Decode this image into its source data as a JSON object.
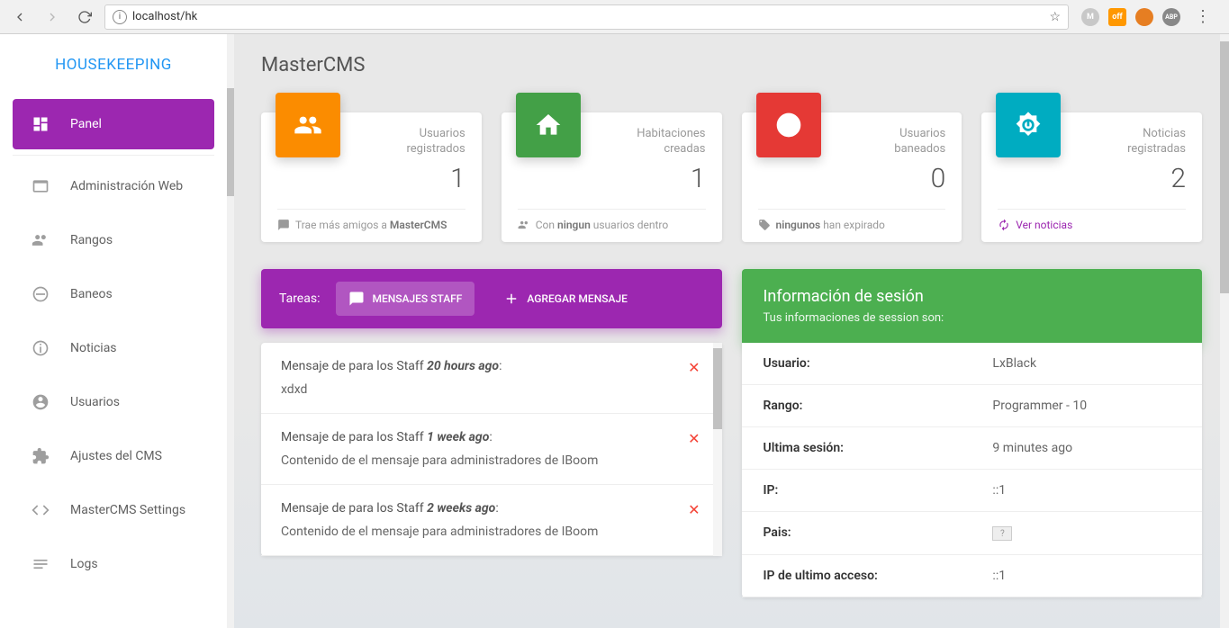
{
  "browser": {
    "url": "localhost/hk"
  },
  "sidebar": {
    "title": "HOUSEKEEPING",
    "items": [
      {
        "label": "Panel"
      },
      {
        "label": "Administración Web"
      },
      {
        "label": "Rangos"
      },
      {
        "label": "Baneos"
      },
      {
        "label": "Noticias"
      },
      {
        "label": "Usuarios"
      },
      {
        "label": "Ajustes del CMS"
      },
      {
        "label": "MasterCMS Settings"
      },
      {
        "label": "Logs"
      }
    ]
  },
  "page": {
    "title": "MasterCMS"
  },
  "stats": [
    {
      "label1": "Usuarios",
      "label2": "registrados",
      "value": "1",
      "footer_pre": "Trae más amigos a ",
      "footer_bold": "MasterCMS",
      "footer_post": "",
      "color": "#fb8c00"
    },
    {
      "label1": "Habitaciones",
      "label2": "creadas",
      "value": "1",
      "footer_pre": "Con ",
      "footer_bold": "ningun",
      "footer_post": " usuarios dentro",
      "color": "#43a047"
    },
    {
      "label1": "Usuarios",
      "label2": "baneados",
      "value": "0",
      "footer_pre": "",
      "footer_bold": "ningunos",
      "footer_post": " han expirado",
      "color": "#e53935"
    },
    {
      "label1": "Noticias",
      "label2": "registradas",
      "value": "2",
      "footer_link": "Ver noticias",
      "color": "#00acc1"
    }
  ],
  "tasks": {
    "label": "Tareas:",
    "tab1": "MENSAJES STAFF",
    "tab2": "AGREGAR MENSAJE"
  },
  "messages": [
    {
      "title_pre": "Mensaje de para los Staff ",
      "time": "20 hours ago",
      "body": "xdxd"
    },
    {
      "title_pre": "Mensaje de para los Staff ",
      "time": "1 week ago",
      "body": "Contenido de el mensaje para administradores de IBoom"
    },
    {
      "title_pre": "Mensaje de para los Staff ",
      "time": "2 weeks ago",
      "body": "Contenido de el mensaje para administradores de IBoom"
    }
  ],
  "session": {
    "title": "Información de sesión",
    "subtitle": "Tus informaciones de session son:",
    "rows": [
      {
        "label": "Usuario:",
        "value": "LxBlack"
      },
      {
        "label": "Rango:",
        "value": "Programmer - 10"
      },
      {
        "label": "Ultima sesión:",
        "value": "9 minutes ago"
      },
      {
        "label": "IP:",
        "value": "::1"
      },
      {
        "label": "Pais:",
        "value": "?"
      },
      {
        "label": "IP de ultimo acceso:",
        "value": "::1"
      }
    ]
  }
}
